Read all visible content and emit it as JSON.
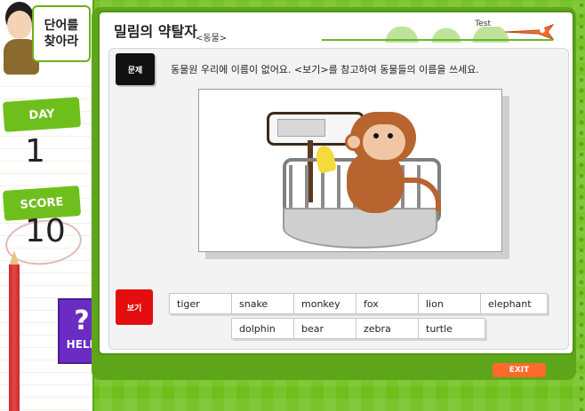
{
  "sidebar": {
    "title_line1": "단어를",
    "title_line2": "찾아라",
    "day_label": "DAY",
    "day_value": "1",
    "score_label": "SCORE",
    "score_value": "10",
    "help_icon": "?",
    "help_label": "HELP"
  },
  "header": {
    "title": "밀림의 약탈자",
    "subtitle": "<동물>",
    "test_tag": "Test"
  },
  "question": {
    "badge": "문제",
    "text": "동물원 우리에 이름이 없어요. <보기>를 참고하여 동물들의 이름을 쓰세요."
  },
  "choices": {
    "badge": "보기",
    "row1": [
      "tiger",
      "snake",
      "monkey",
      "fox",
      "lion",
      "elephant"
    ],
    "row2": [
      "dolphin",
      "bear",
      "zebra",
      "turtle"
    ]
  },
  "footer": {
    "exit": "EXIT"
  },
  "icons": {
    "help": "question-mark-icon",
    "plane": "airplane-icon"
  },
  "colors": {
    "board_green": "#5da619",
    "accent_red": "#e50e0e",
    "help_purple": "#6a2cc2",
    "exit_orange": "#ff6a2a"
  }
}
